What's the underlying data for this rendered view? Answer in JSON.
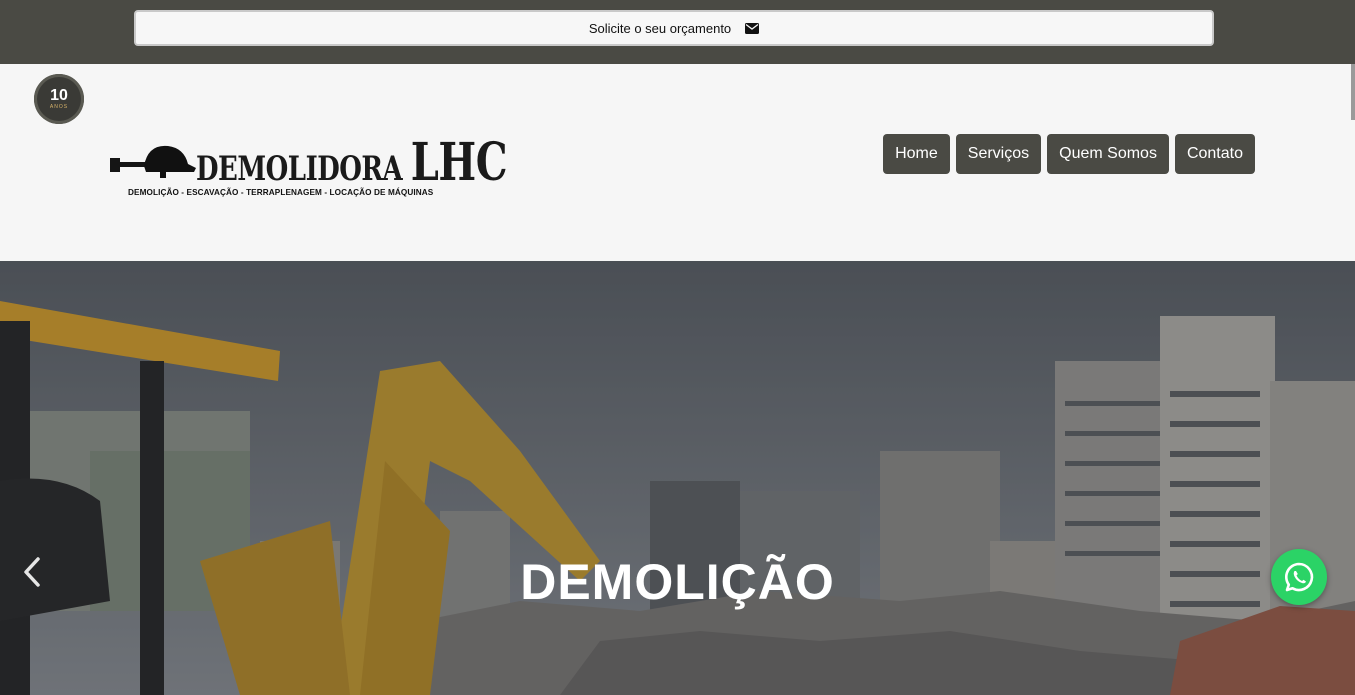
{
  "topbar": {
    "quote_label": "Solicite o seu orçamento",
    "quote_icon": "envelope-icon"
  },
  "badge": {
    "number": "10",
    "sub": "ANOS"
  },
  "logo": {
    "title_part1": "DEMOLIDORA",
    "title_part2": "LHC",
    "tagline": "DEMOLIÇÃO - ESCAVAÇÃO - TERRAPLENAGEM - LOCAÇÃO DE MÁQUINAS"
  },
  "nav": {
    "items": [
      {
        "label": "Home"
      },
      {
        "label": "Serviços"
      },
      {
        "label": "Quem Somos"
      },
      {
        "label": "Contato"
      }
    ]
  },
  "hero": {
    "title": "DEMOLIÇÃO",
    "prev_icon": "chevron-left-icon"
  },
  "floating": {
    "whatsapp_icon": "whatsapp-icon"
  },
  "colors": {
    "topbar": "#4a4a44",
    "nav_button": "#4a4a44",
    "whatsapp": "#2bd366",
    "excavator": "#e0a526"
  }
}
